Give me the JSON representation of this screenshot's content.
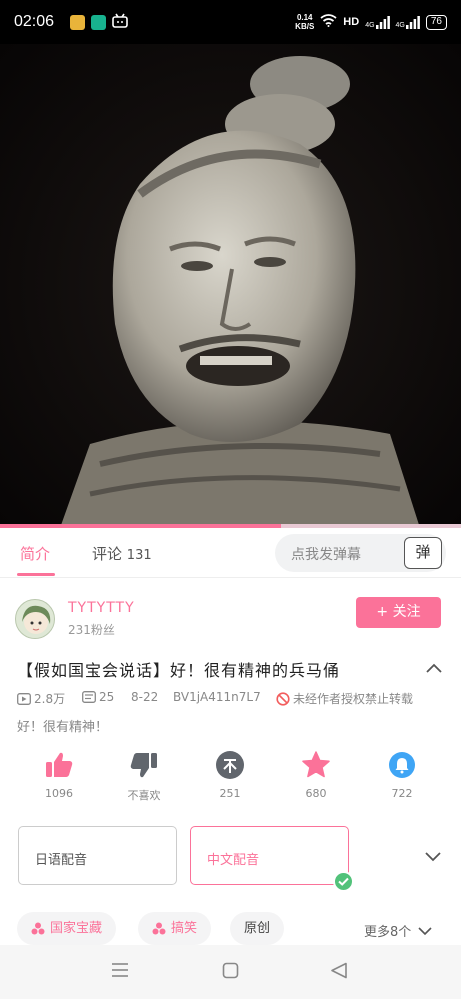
{
  "status_bar": {
    "time": "02:06",
    "speed_value": "0.14",
    "speed_unit": "KB/S",
    "hd_label": "HD",
    "net1": "4G",
    "net2": "4G",
    "battery": "76",
    "app_icon_colors": [
      "#e9b43a",
      "#18b28f",
      "#ffffff"
    ]
  },
  "player": {
    "progress": 0.61
  },
  "tabs": {
    "intro": "简介",
    "comments": "评论",
    "comments_count": "131"
  },
  "danmaku": {
    "placeholder": "点我发弹幕",
    "button": "弹"
  },
  "author": {
    "name": "TYTYTTY",
    "fans": "231粉丝",
    "follow_label": "+ 关注"
  },
  "video": {
    "title": "【假如国宝会说话】好！很有精神的兵马俑",
    "views": "2.8万",
    "danmaku_count": "25",
    "date": "8-22",
    "bvid": "BV1jA411n7L7",
    "copyright_notice": "未经作者授权禁止转载",
    "description": "好！很有精神！"
  },
  "actions": [
    {
      "icon": "thumbs-up-icon",
      "label": "1096",
      "color": "#fb7299"
    },
    {
      "icon": "thumbs-down-icon",
      "label": "不喜欢",
      "color": "#61666d"
    },
    {
      "icon": "coin-icon",
      "label": "251",
      "color": "#61666d"
    },
    {
      "icon": "star-icon",
      "label": "680",
      "color": "#fb7299"
    },
    {
      "icon": "share-icon",
      "label": "722",
      "color": "#3fa5f5"
    }
  ],
  "dubbing": {
    "options": [
      "日语配音",
      "中文配音"
    ],
    "selected": "中文配音"
  },
  "tags": {
    "items": [
      "国家宝藏",
      "搞笑",
      "原创"
    ],
    "more": "更多8个"
  },
  "colors": {
    "accent": "#fb7299",
    "success": "#52c27a"
  }
}
